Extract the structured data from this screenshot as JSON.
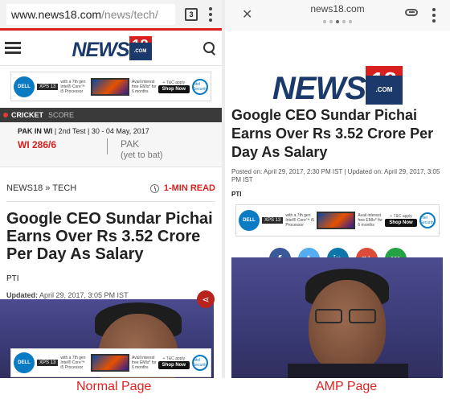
{
  "left": {
    "url_host": "www.news18.com",
    "url_path": "/news/tech/",
    "tab_count": "3",
    "logo_text": "NEWS",
    "logo_number": "18",
    "logo_dotcom": ".COM",
    "ad": {
      "brand": "DELL",
      "model": "XPS 13",
      "text": "with a 7th gen Intel® Core™ i5 Processor",
      "tc": "+ T&C apply",
      "offer": "Avail interest free EMIs* for 6 months",
      "cta": "Shop Now",
      "intel": "intel Security",
      "fine": "Protect every device you own with preloaded McAfee LiveSafe™ for 12 months"
    },
    "cricket": {
      "label": "CRICKET",
      "sub": "SCORE"
    },
    "match": {
      "teams": "PAK IN WI",
      "info": " | 2nd Test | 30 - 04 May, 2017"
    },
    "score_wi": "WI 286/6",
    "score_pak": "PAK",
    "score_pak_note": "(yet to bat)",
    "breadcrumb": "NEWS18 » TECH",
    "read_time": "1-MIN READ",
    "headline": "Google CEO Sundar Pichai Earns Over Rs 3.52 Crore Per Day As Salary",
    "byline": "PTI",
    "updated_label": "Updated:",
    "updated_value": " April 29, 2017, 3:05 PM IST"
  },
  "right": {
    "url": "news18.com",
    "logo_text": "NEWS",
    "logo_number": "18",
    "logo_dotcom": ".COM",
    "headline": "Google CEO Sundar Pichai Earns Over Rs 3.52 Crore Per Day As Salary",
    "meta": "Posted on: April 29, 2017, 2:30 PM IST | Updated on: April 29, 2017, 3:05 PM IST",
    "byline": "PTI",
    "social": [
      "f",
      "t",
      "in",
      "g+",
      "w"
    ]
  },
  "captions": {
    "left": "Normal Page",
    "right": "AMP Page"
  }
}
